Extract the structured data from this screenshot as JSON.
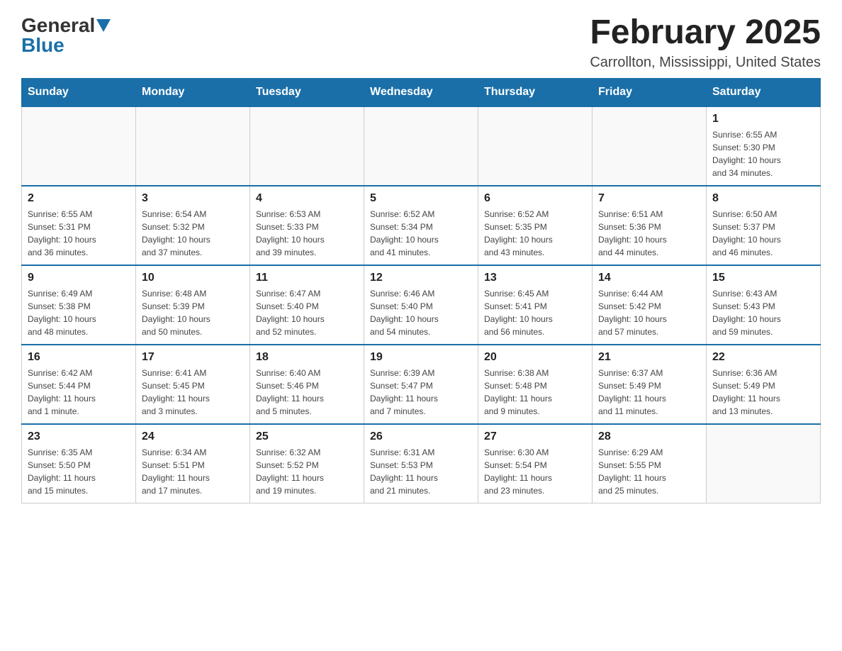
{
  "logo": {
    "general": "General",
    "arrow": "▼",
    "blue": "Blue"
  },
  "header": {
    "title": "February 2025",
    "location": "Carrollton, Mississippi, United States"
  },
  "days_of_week": [
    "Sunday",
    "Monday",
    "Tuesday",
    "Wednesday",
    "Thursday",
    "Friday",
    "Saturday"
  ],
  "weeks": [
    {
      "days": [
        {
          "number": "",
          "info": ""
        },
        {
          "number": "",
          "info": ""
        },
        {
          "number": "",
          "info": ""
        },
        {
          "number": "",
          "info": ""
        },
        {
          "number": "",
          "info": ""
        },
        {
          "number": "",
          "info": ""
        },
        {
          "number": "1",
          "info": "Sunrise: 6:55 AM\nSunset: 5:30 PM\nDaylight: 10 hours\nand 34 minutes."
        }
      ]
    },
    {
      "days": [
        {
          "number": "2",
          "info": "Sunrise: 6:55 AM\nSunset: 5:31 PM\nDaylight: 10 hours\nand 36 minutes."
        },
        {
          "number": "3",
          "info": "Sunrise: 6:54 AM\nSunset: 5:32 PM\nDaylight: 10 hours\nand 37 minutes."
        },
        {
          "number": "4",
          "info": "Sunrise: 6:53 AM\nSunset: 5:33 PM\nDaylight: 10 hours\nand 39 minutes."
        },
        {
          "number": "5",
          "info": "Sunrise: 6:52 AM\nSunset: 5:34 PM\nDaylight: 10 hours\nand 41 minutes."
        },
        {
          "number": "6",
          "info": "Sunrise: 6:52 AM\nSunset: 5:35 PM\nDaylight: 10 hours\nand 43 minutes."
        },
        {
          "number": "7",
          "info": "Sunrise: 6:51 AM\nSunset: 5:36 PM\nDaylight: 10 hours\nand 44 minutes."
        },
        {
          "number": "8",
          "info": "Sunrise: 6:50 AM\nSunset: 5:37 PM\nDaylight: 10 hours\nand 46 minutes."
        }
      ]
    },
    {
      "days": [
        {
          "number": "9",
          "info": "Sunrise: 6:49 AM\nSunset: 5:38 PM\nDaylight: 10 hours\nand 48 minutes."
        },
        {
          "number": "10",
          "info": "Sunrise: 6:48 AM\nSunset: 5:39 PM\nDaylight: 10 hours\nand 50 minutes."
        },
        {
          "number": "11",
          "info": "Sunrise: 6:47 AM\nSunset: 5:40 PM\nDaylight: 10 hours\nand 52 minutes."
        },
        {
          "number": "12",
          "info": "Sunrise: 6:46 AM\nSunset: 5:40 PM\nDaylight: 10 hours\nand 54 minutes."
        },
        {
          "number": "13",
          "info": "Sunrise: 6:45 AM\nSunset: 5:41 PM\nDaylight: 10 hours\nand 56 minutes."
        },
        {
          "number": "14",
          "info": "Sunrise: 6:44 AM\nSunset: 5:42 PM\nDaylight: 10 hours\nand 57 minutes."
        },
        {
          "number": "15",
          "info": "Sunrise: 6:43 AM\nSunset: 5:43 PM\nDaylight: 10 hours\nand 59 minutes."
        }
      ]
    },
    {
      "days": [
        {
          "number": "16",
          "info": "Sunrise: 6:42 AM\nSunset: 5:44 PM\nDaylight: 11 hours\nand 1 minute."
        },
        {
          "number": "17",
          "info": "Sunrise: 6:41 AM\nSunset: 5:45 PM\nDaylight: 11 hours\nand 3 minutes."
        },
        {
          "number": "18",
          "info": "Sunrise: 6:40 AM\nSunset: 5:46 PM\nDaylight: 11 hours\nand 5 minutes."
        },
        {
          "number": "19",
          "info": "Sunrise: 6:39 AM\nSunset: 5:47 PM\nDaylight: 11 hours\nand 7 minutes."
        },
        {
          "number": "20",
          "info": "Sunrise: 6:38 AM\nSunset: 5:48 PM\nDaylight: 11 hours\nand 9 minutes."
        },
        {
          "number": "21",
          "info": "Sunrise: 6:37 AM\nSunset: 5:49 PM\nDaylight: 11 hours\nand 11 minutes."
        },
        {
          "number": "22",
          "info": "Sunrise: 6:36 AM\nSunset: 5:49 PM\nDaylight: 11 hours\nand 13 minutes."
        }
      ]
    },
    {
      "days": [
        {
          "number": "23",
          "info": "Sunrise: 6:35 AM\nSunset: 5:50 PM\nDaylight: 11 hours\nand 15 minutes."
        },
        {
          "number": "24",
          "info": "Sunrise: 6:34 AM\nSunset: 5:51 PM\nDaylight: 11 hours\nand 17 minutes."
        },
        {
          "number": "25",
          "info": "Sunrise: 6:32 AM\nSunset: 5:52 PM\nDaylight: 11 hours\nand 19 minutes."
        },
        {
          "number": "26",
          "info": "Sunrise: 6:31 AM\nSunset: 5:53 PM\nDaylight: 11 hours\nand 21 minutes."
        },
        {
          "number": "27",
          "info": "Sunrise: 6:30 AM\nSunset: 5:54 PM\nDaylight: 11 hours\nand 23 minutes."
        },
        {
          "number": "28",
          "info": "Sunrise: 6:29 AM\nSunset: 5:55 PM\nDaylight: 11 hours\nand 25 minutes."
        },
        {
          "number": "",
          "info": ""
        }
      ]
    }
  ]
}
